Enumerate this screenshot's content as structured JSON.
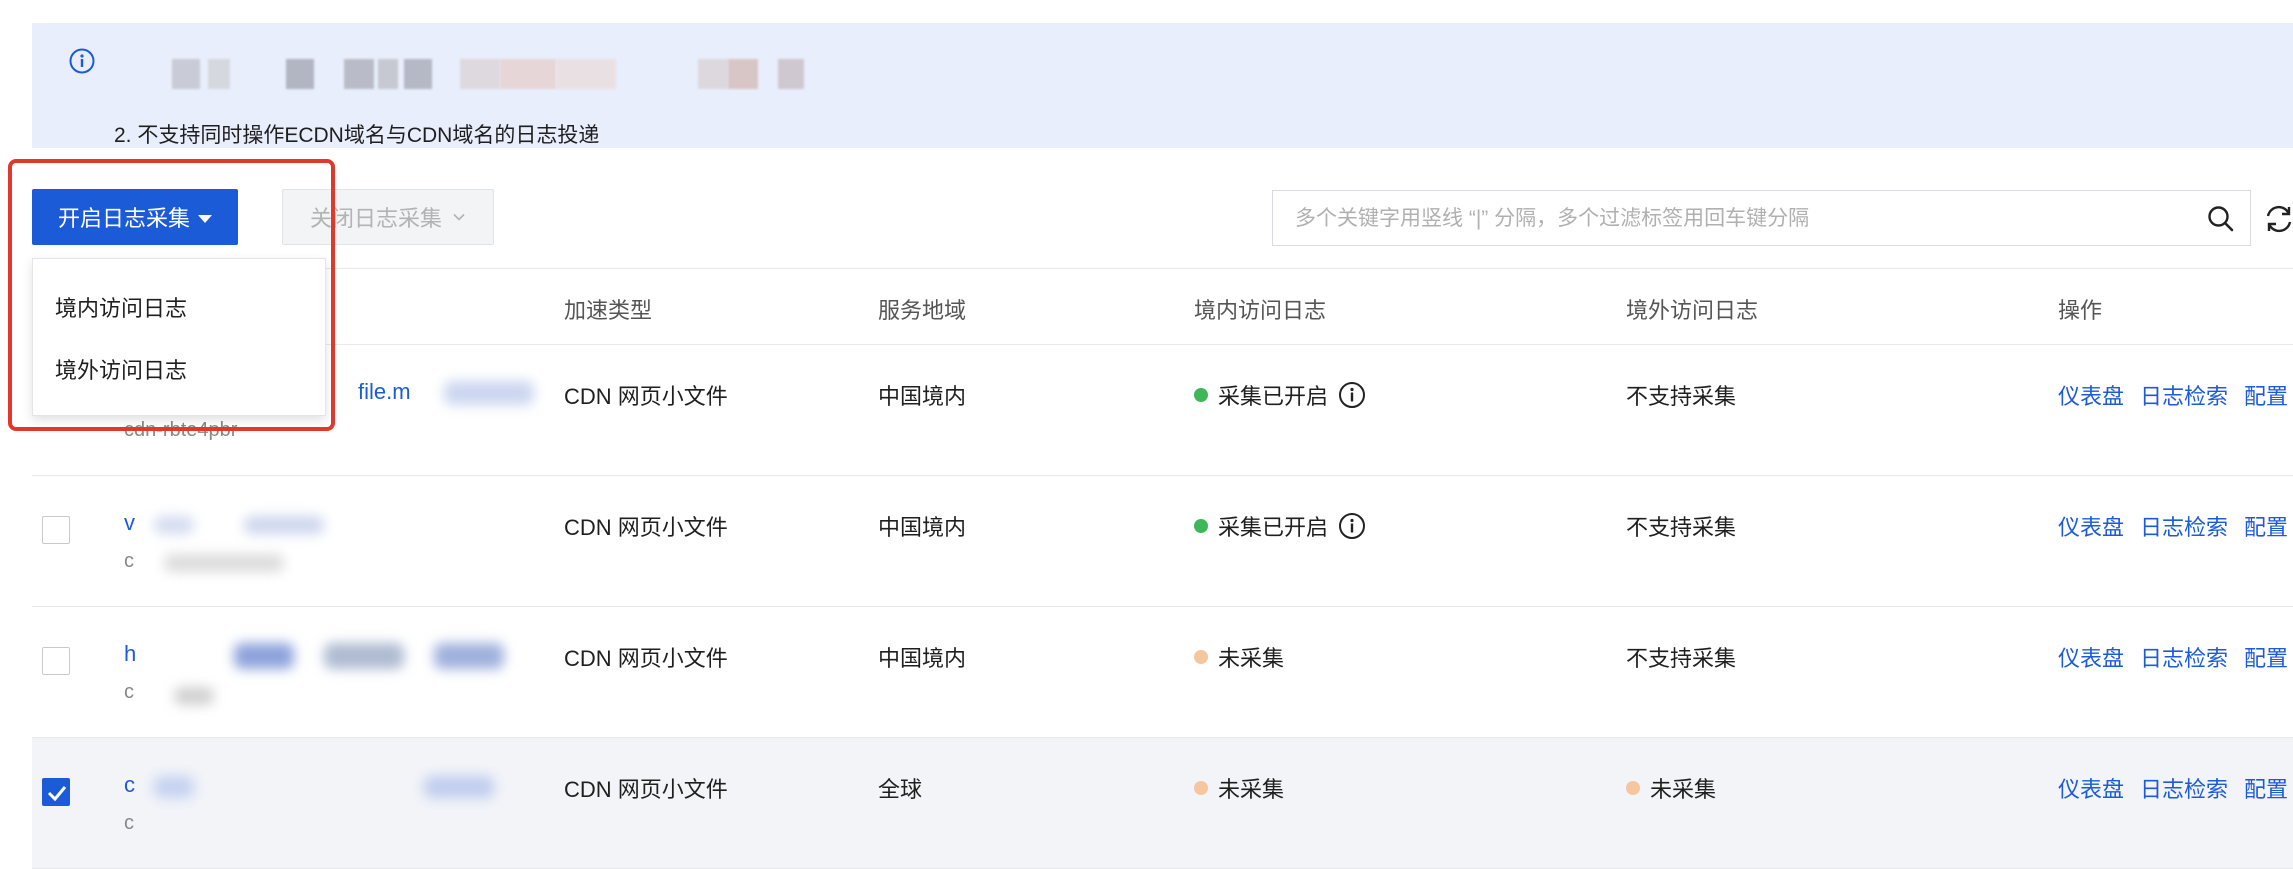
{
  "notice": {
    "line2": "2. 不支持同时操作ECDN域名与CDN域名的日志投递"
  },
  "toolbar": {
    "open_label": "开启日志采集",
    "close_label": "关闭日志采集",
    "search_placeholder": "多个关键字用竖线 “|” 分隔，多个过滤标签用回车键分隔"
  },
  "dropdown": {
    "options": [
      "境内访问日志",
      "境外访问日志"
    ]
  },
  "table": {
    "columns": [
      "加速类型",
      "服务地域",
      "境内访问日志",
      "境外访问日志",
      "操作"
    ],
    "rows": [
      {
        "name_fragment": "file.m",
        "sub_fragment": "cdn-rbte4pbr",
        "accel": "CDN 网页小文件",
        "region": "中国境内",
        "domestic": "采集已开启",
        "domestic_status": "on",
        "overseas": "不支持采集",
        "checked": false
      },
      {
        "name_fragment": "v",
        "sub_fragment": "c",
        "accel": "CDN 网页小文件",
        "region": "中国境内",
        "domestic": "采集已开启",
        "domestic_status": "on",
        "overseas": "不支持采集",
        "checked": false
      },
      {
        "name_fragment": "h",
        "sub_fragment": "c",
        "accel": "CDN 网页小文件",
        "region": "中国境内",
        "domestic": "未采集",
        "domestic_status": "off",
        "overseas": "不支持采集",
        "checked": false
      },
      {
        "name_fragment": "c",
        "sub_fragment": "c",
        "accel": "CDN 网页小文件",
        "region": "全球",
        "domestic": "未采集",
        "domestic_status": "off",
        "overseas": "未采集",
        "overseas_status": "off",
        "checked": true
      }
    ],
    "actions": [
      "仪表盘",
      "日志检索",
      "配置"
    ]
  },
  "colors": {
    "primary": "#1c5bd8",
    "status_on": "#3db858",
    "status_off": "#f5c79e",
    "highlight": "#e0392c",
    "banner_bg": "#e9eefc"
  },
  "icons": [
    "info-icon",
    "chevron-down-icon",
    "search-icon",
    "refresh-icon",
    "checkmark-icon"
  ]
}
